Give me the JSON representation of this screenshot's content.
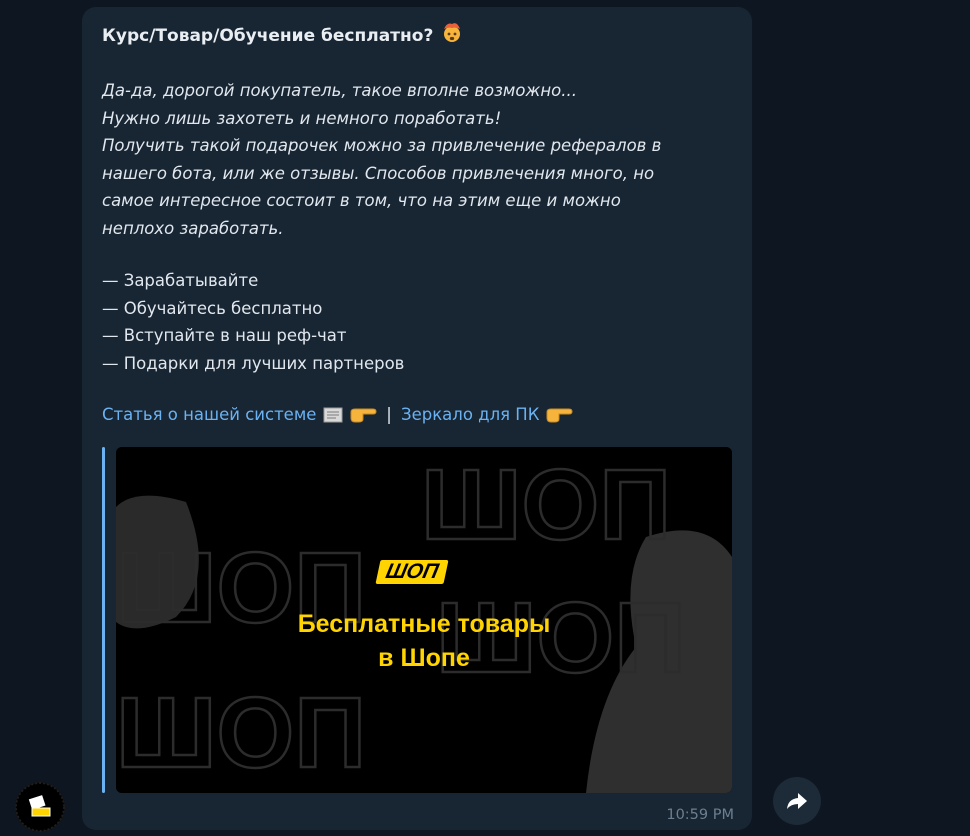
{
  "message": {
    "title": "Курс/Товар/Обучение бесплатно?",
    "title_emoji": "exploding-head-emoji",
    "italic_lines": [
      "Да-да, дорогой покупатель, такое вполне возможно...",
      "Нужно лишь захотеть и немного поработать!",
      "Получить такой подарочек можно за привлечение рефералов в",
      "нашего бота, или же отзывы. Способов привлечения много, но",
      "самое интересное состоит в том, что на этим еще и можно",
      "неплохо заработать."
    ],
    "bullets": [
      "— Зарабатывайте",
      "— Обучайтесь бесплатно",
      "— Вступайте в наш реф-чат",
      "— Подарки для лучших партнеров"
    ],
    "link1": "Статья о нашей системе",
    "separator": "|",
    "link2": "Зеркало для ПК",
    "time": "10:59 PM"
  },
  "preview": {
    "logo": "ШОП",
    "headline_line1": "Бесплатные товары",
    "headline_line2": "в Шопе",
    "background_word": "ШОП"
  },
  "colors": {
    "background": "#0e1621",
    "bubble": "#182533",
    "link": "#6ab2f2",
    "accent_yellow": "#ffd400"
  },
  "icons": {
    "avatar": "channel-avatar-icon",
    "share": "share-arrow-icon",
    "pointing": "backhand-index-pointing-right-emoji",
    "scroll": "newspaper-emoji"
  }
}
